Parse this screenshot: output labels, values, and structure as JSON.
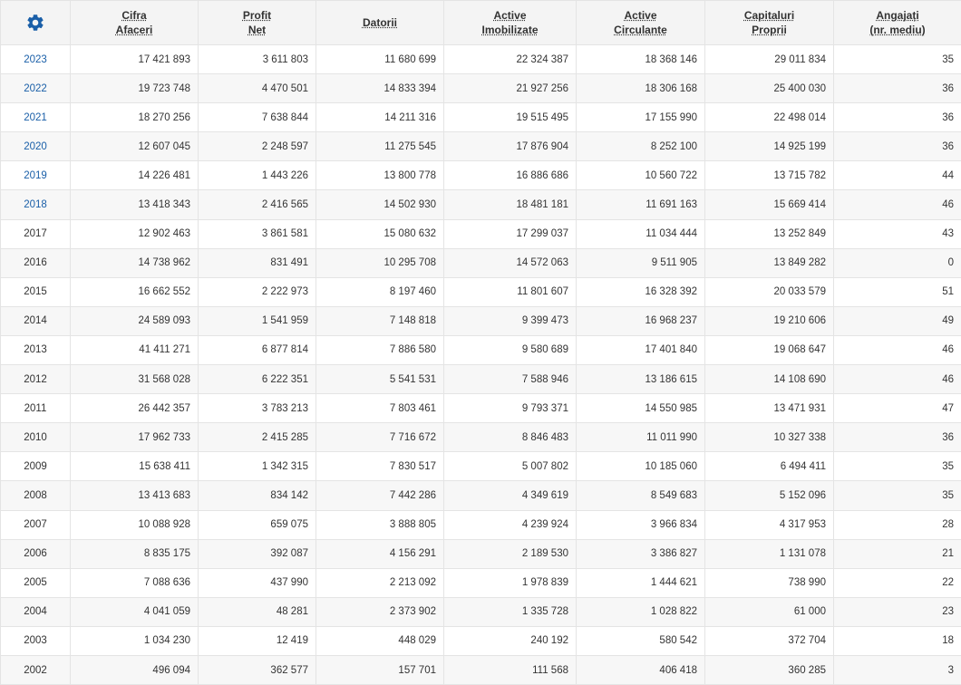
{
  "accent_color": "#1a5fa8",
  "settings_icon": "gear-icon",
  "columns": [
    {
      "line1": "Cifra",
      "line2": "Afaceri"
    },
    {
      "line1": "Profit",
      "line2": "Net"
    },
    {
      "line1": "Datorii",
      "line2": ""
    },
    {
      "line1": "Active",
      "line2": "Imobilizate"
    },
    {
      "line1": "Active",
      "line2": "Circulante"
    },
    {
      "line1": "Capitaluri",
      "line2": "Proprii"
    },
    {
      "line1": "Angajați",
      "line2": "(nr. mediu)"
    }
  ],
  "rows": [
    {
      "year": "2023",
      "link": true,
      "values": [
        "17 421 893",
        "3 611 803",
        "11 680 699",
        "22 324 387",
        "18 368 146",
        "29 011 834",
        "35"
      ]
    },
    {
      "year": "2022",
      "link": true,
      "values": [
        "19 723 748",
        "4 470 501",
        "14 833 394",
        "21 927 256",
        "18 306 168",
        "25 400 030",
        "36"
      ]
    },
    {
      "year": "2021",
      "link": true,
      "values": [
        "18 270 256",
        "7 638 844",
        "14 211 316",
        "19 515 495",
        "17 155 990",
        "22 498 014",
        "36"
      ]
    },
    {
      "year": "2020",
      "link": true,
      "values": [
        "12 607 045",
        "2 248 597",
        "11 275 545",
        "17 876 904",
        "8 252 100",
        "14 925 199",
        "36"
      ]
    },
    {
      "year": "2019",
      "link": true,
      "values": [
        "14 226 481",
        "1 443 226",
        "13 800 778",
        "16 886 686",
        "10 560 722",
        "13 715 782",
        "44"
      ]
    },
    {
      "year": "2018",
      "link": true,
      "values": [
        "13 418 343",
        "2 416 565",
        "14 502 930",
        "18 481 181",
        "11 691 163",
        "15 669 414",
        "46"
      ]
    },
    {
      "year": "2017",
      "link": false,
      "values": [
        "12 902 463",
        "3 861 581",
        "15 080 632",
        "17 299 037",
        "11 034 444",
        "13 252 849",
        "43"
      ]
    },
    {
      "year": "2016",
      "link": false,
      "values": [
        "14 738 962",
        "831 491",
        "10 295 708",
        "14 572 063",
        "9 511 905",
        "13 849 282",
        "0"
      ]
    },
    {
      "year": "2015",
      "link": false,
      "values": [
        "16 662 552",
        "2 222 973",
        "8 197 460",
        "11 801 607",
        "16 328 392",
        "20 033 579",
        "51"
      ]
    },
    {
      "year": "2014",
      "link": false,
      "values": [
        "24 589 093",
        "1 541 959",
        "7 148 818",
        "9 399 473",
        "16 968 237",
        "19 210 606",
        "49"
      ]
    },
    {
      "year": "2013",
      "link": false,
      "values": [
        "41 411 271",
        "6 877 814",
        "7 886 580",
        "9 580 689",
        "17 401 840",
        "19 068 647",
        "46"
      ]
    },
    {
      "year": "2012",
      "link": false,
      "values": [
        "31 568 028",
        "6 222 351",
        "5 541 531",
        "7 588 946",
        "13 186 615",
        "14 108 690",
        "46"
      ]
    },
    {
      "year": "2011",
      "link": false,
      "values": [
        "26 442 357",
        "3 783 213",
        "7 803 461",
        "9 793 371",
        "14 550 985",
        "13 471 931",
        "47"
      ]
    },
    {
      "year": "2010",
      "link": false,
      "values": [
        "17 962 733",
        "2 415 285",
        "7 716 672",
        "8 846 483",
        "11 011 990",
        "10 327 338",
        "36"
      ]
    },
    {
      "year": "2009",
      "link": false,
      "values": [
        "15 638 411",
        "1 342 315",
        "7 830 517",
        "5 007 802",
        "10 185 060",
        "6 494 411",
        "35"
      ]
    },
    {
      "year": "2008",
      "link": false,
      "values": [
        "13 413 683",
        "834 142",
        "7 442 286",
        "4 349 619",
        "8 549 683",
        "5 152 096",
        "35"
      ]
    },
    {
      "year": "2007",
      "link": false,
      "values": [
        "10 088 928",
        "659 075",
        "3 888 805",
        "4 239 924",
        "3 966 834",
        "4 317 953",
        "28"
      ]
    },
    {
      "year": "2006",
      "link": false,
      "values": [
        "8 835 175",
        "392 087",
        "4 156 291",
        "2 189 530",
        "3 386 827",
        "1 131 078",
        "21"
      ]
    },
    {
      "year": "2005",
      "link": false,
      "values": [
        "7 088 636",
        "437 990",
        "2 213 092",
        "1 978 839",
        "1 444 621",
        "738 990",
        "22"
      ]
    },
    {
      "year": "2004",
      "link": false,
      "values": [
        "4 041 059",
        "48 281",
        "2 373 902",
        "1 335 728",
        "1 028 822",
        "61 000",
        "23"
      ]
    },
    {
      "year": "2003",
      "link": false,
      "values": [
        "1 034 230",
        "12 419",
        "448 029",
        "240 192",
        "580 542",
        "372 704",
        "18"
      ]
    },
    {
      "year": "2002",
      "link": false,
      "values": [
        "496 094",
        "362 577",
        "157 701",
        "111 568",
        "406 418",
        "360 285",
        "3"
      ]
    }
  ]
}
